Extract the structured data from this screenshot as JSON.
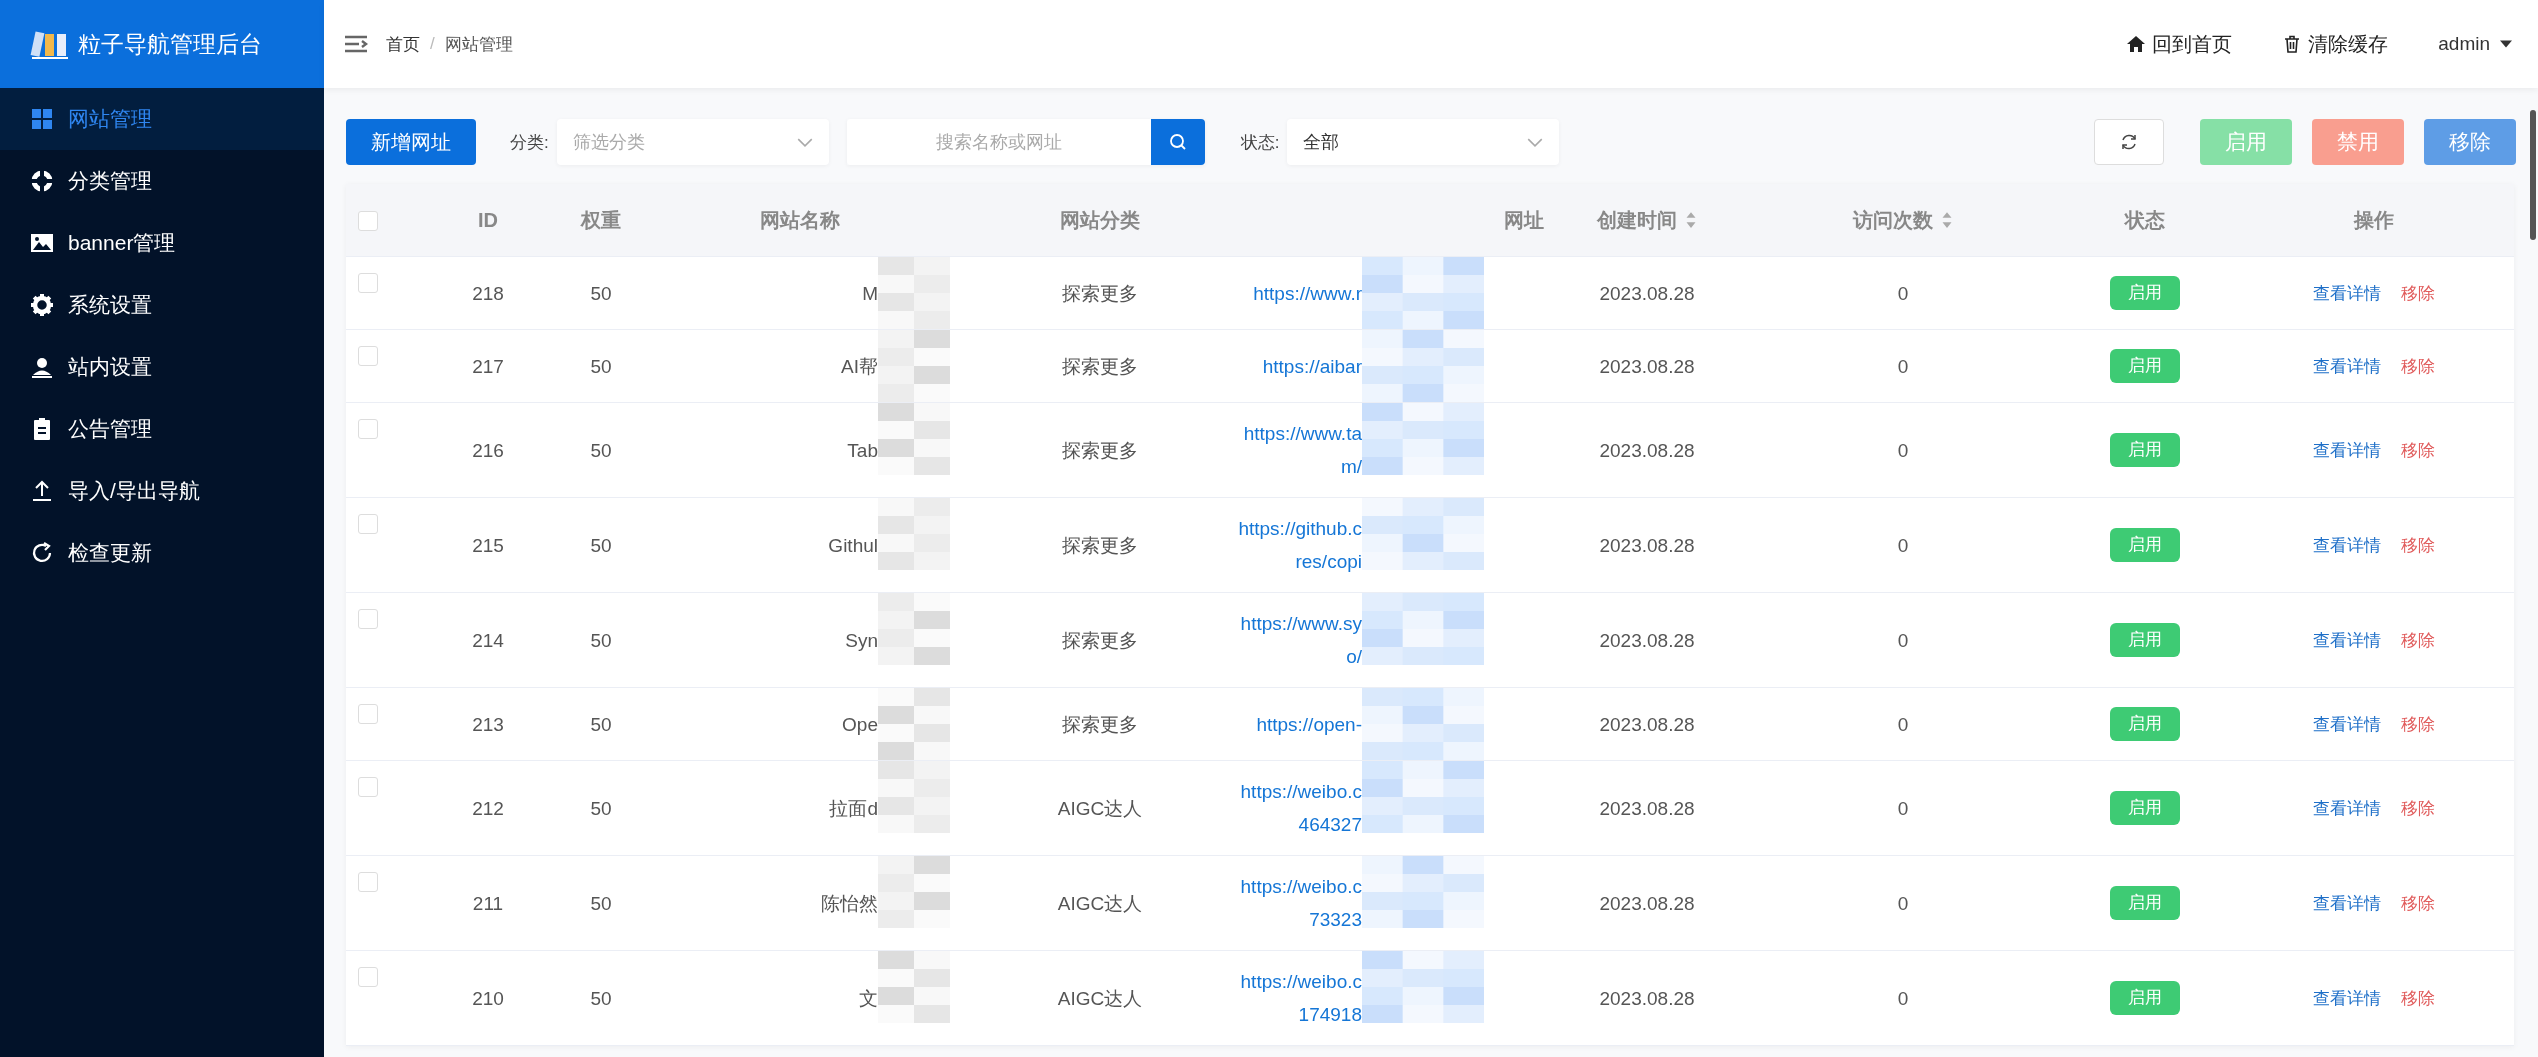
{
  "sidebar": {
    "title": "粒子导航管理后台",
    "items": [
      {
        "label": "网站管理",
        "selected": true
      },
      {
        "label": "分类管理",
        "selected": false
      },
      {
        "label": "banner管理",
        "selected": false
      },
      {
        "label": "系统设置",
        "selected": false
      },
      {
        "label": "站内设置",
        "selected": false
      },
      {
        "label": "公告管理",
        "selected": false
      },
      {
        "label": "导入/导出导航",
        "selected": false
      },
      {
        "label": "检查更新",
        "selected": false
      }
    ]
  },
  "header": {
    "breadcrumb": [
      "首页",
      "网站管理"
    ],
    "separator": "/",
    "actions": [
      {
        "label": "回到首页"
      },
      {
        "label": "清除缓存"
      }
    ],
    "user": "admin"
  },
  "toolbar": {
    "add_button": "新增网址",
    "category_label": "分类:",
    "category_placeholder": "筛选分类",
    "search_placeholder": "搜索名称或网址",
    "status_label": "状态:",
    "status_value": "全部",
    "buttons": [
      {
        "label": "启用",
        "kind": "enable"
      },
      {
        "label": "禁用",
        "kind": "disable"
      },
      {
        "label": "移除",
        "kind": "remove"
      }
    ]
  },
  "table": {
    "select_all_checked": false,
    "columns": [
      {
        "label": "ID",
        "sortable": false
      },
      {
        "label": "权重",
        "sortable": false
      },
      {
        "label": "网站名称",
        "sortable": false
      },
      {
        "label": "网站分类",
        "sortable": false
      },
      {
        "label": "网址",
        "sortable": false
      },
      {
        "label": "创建时间",
        "sortable": true
      },
      {
        "label": "访问次数",
        "sortable": true
      },
      {
        "label": "状态",
        "sortable": false
      },
      {
        "label": "操作",
        "sortable": false
      }
    ],
    "rows": [
      {
        "checked": false,
        "id": "218",
        "weight": "50",
        "name": "M",
        "category": "探索更多",
        "url": [
          "https://www.r"
        ],
        "created": "2023.08.28",
        "visits": "0",
        "status": "启用",
        "enabled": true,
        "actions": [
          "查看详情",
          "移除"
        ]
      },
      {
        "checked": false,
        "id": "217",
        "weight": "50",
        "name": "AI帮",
        "category": "探索更多",
        "url": [
          "https://aibar"
        ],
        "created": "2023.08.28",
        "visits": "0",
        "status": "启用",
        "enabled": true,
        "actions": [
          "查看详情",
          "移除"
        ]
      },
      {
        "checked": false,
        "id": "216",
        "weight": "50",
        "name": "Tab",
        "category": "探索更多",
        "url": [
          "https://www.ta",
          "m/"
        ],
        "created": "2023.08.28",
        "visits": "0",
        "status": "启用",
        "enabled": true,
        "actions": [
          "查看详情",
          "移除"
        ]
      },
      {
        "checked": false,
        "id": "215",
        "weight": "50",
        "name": "Githul",
        "category": "探索更多",
        "url": [
          "https://github.c",
          "res/copi"
        ],
        "created": "2023.08.28",
        "visits": "0",
        "status": "启用",
        "enabled": true,
        "actions": [
          "查看详情",
          "移除"
        ]
      },
      {
        "checked": false,
        "id": "214",
        "weight": "50",
        "name": "Syn",
        "category": "探索更多",
        "url": [
          "https://www.sy",
          "o/"
        ],
        "created": "2023.08.28",
        "visits": "0",
        "status": "启用",
        "enabled": true,
        "actions": [
          "查看详情",
          "移除"
        ]
      },
      {
        "checked": false,
        "id": "213",
        "weight": "50",
        "name": "Ope",
        "category": "探索更多",
        "url": [
          "https://open-"
        ],
        "created": "2023.08.28",
        "visits": "0",
        "status": "启用",
        "enabled": true,
        "actions": [
          "查看详情",
          "移除"
        ]
      },
      {
        "checked": false,
        "id": "212",
        "weight": "50",
        "name": "拉面d",
        "category": "AIGC达人",
        "url": [
          "https://weibo.c",
          "464327"
        ],
        "created": "2023.08.28",
        "visits": "0",
        "status": "启用",
        "enabled": true,
        "actions": [
          "查看详情",
          "移除"
        ]
      },
      {
        "checked": false,
        "id": "211",
        "weight": "50",
        "name": "陈怡然",
        "category": "AIGC达人",
        "url": [
          "https://weibo.c",
          "73323"
        ],
        "created": "2023.08.28",
        "visits": "0",
        "status": "启用",
        "enabled": true,
        "actions": [
          "查看详情",
          "移除"
        ]
      },
      {
        "checked": false,
        "id": "210",
        "weight": "50",
        "name": "文",
        "category": "AIGC达人",
        "url": [
          "https://weibo.c",
          "174918"
        ],
        "created": "2023.08.28",
        "visits": "0",
        "status": "启用",
        "enabled": true,
        "actions": [
          "查看详情",
          "移除"
        ]
      }
    ]
  }
}
